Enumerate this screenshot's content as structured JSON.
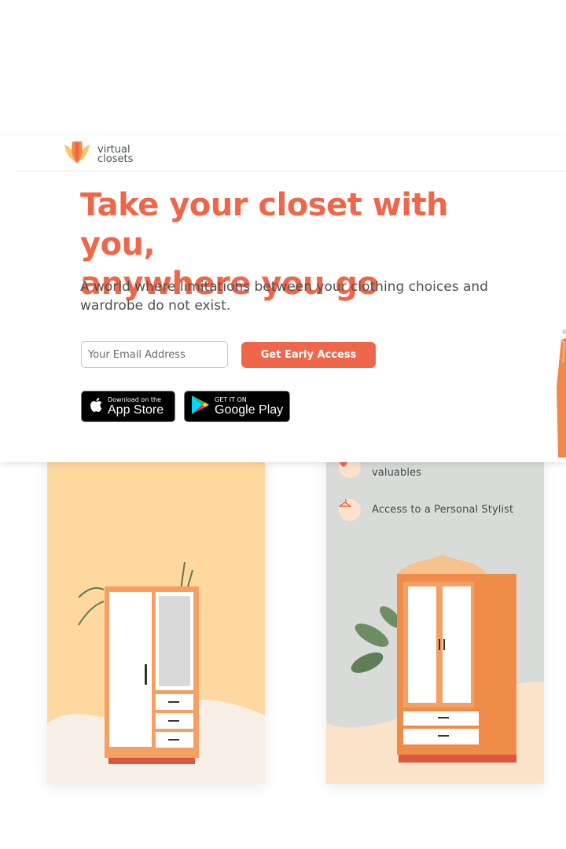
{
  "brand": {
    "name_line1": "virtual",
    "name_line2": "closets",
    "accent_color": "#f0664a"
  },
  "hero": {
    "title_line1": "Take your closet with you,",
    "title_line2": "anywhere you go",
    "subtitle": "A world where limitations between your clothing choices and wardrobe do not exist.",
    "email_placeholder": "Your Email Address",
    "cta_label": "Get Early Access"
  },
  "stores": {
    "apple_small": "Download on the",
    "apple_big": "App Store",
    "google_small": "GET IT ON",
    "google_big": "Google Play"
  },
  "features": [
    {
      "icon": "shield-icon",
      "label": "valuables"
    },
    {
      "icon": "hanger-icon",
      "label": "Access to a Personal Stylist"
    }
  ]
}
